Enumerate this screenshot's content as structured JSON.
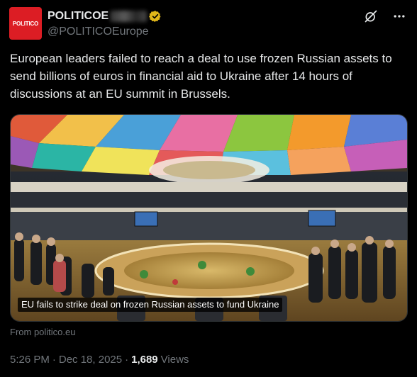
{
  "author": {
    "avatar_text": "POLITICO",
    "display_name": "POLITICOE",
    "handle": "@POLITICOEurope",
    "brand_color": "#dc1d24",
    "verified_color": "#e2b719"
  },
  "header": {
    "grok_icon": "grok-icon",
    "more_icon": "more-icon"
  },
  "tweet": {
    "text": "European leaders failed to reach a deal to use frozen Russian assets to send billions of euros in financial aid to Ukraine after 14 hours of discussions at an EU summit in Brussels."
  },
  "media": {
    "caption": "EU fails to strike deal on frozen Russian assets to fund Ukraine"
  },
  "link_source": "From politico.eu",
  "meta": {
    "time": "5:26 PM",
    "date": "Dec 18, 2025",
    "views_count": "1,689",
    "views_label": "Views"
  }
}
